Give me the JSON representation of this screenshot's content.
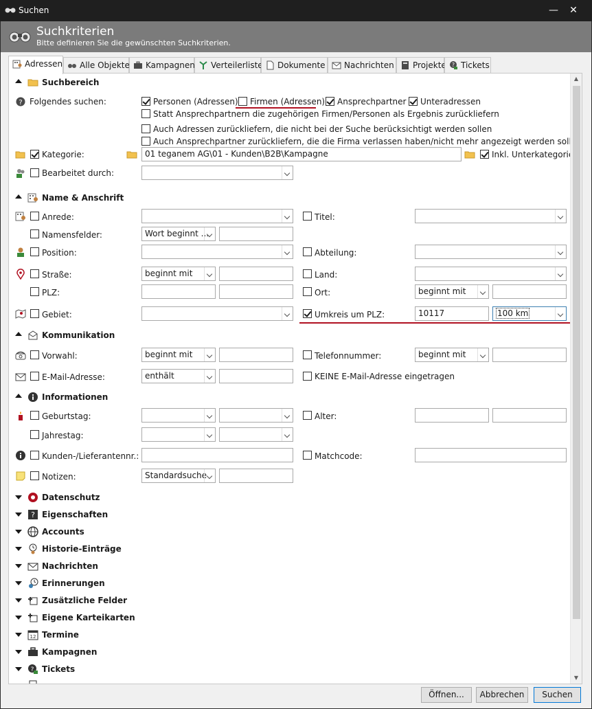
{
  "window": {
    "title": "Suchen",
    "minimize": "—",
    "close": "✕"
  },
  "header": {
    "title": "Suchkriterien",
    "subtitle": "Bitte definieren Sie die gewünschten Suchkriterien."
  },
  "tabs": [
    {
      "label": "Adressen",
      "icon": "address-book-icon",
      "active": true
    },
    {
      "label": "Alle Objekte",
      "icon": "binoculars-icon"
    },
    {
      "label": "Kampagnen",
      "icon": "briefcase-icon"
    },
    {
      "label": "Verteilerlisten",
      "icon": "distribution-icon"
    },
    {
      "label": "Dokumente",
      "icon": "document-icon"
    },
    {
      "label": "Nachrichten",
      "icon": "envelope-icon"
    },
    {
      "label": "Projekte",
      "icon": "book-icon"
    },
    {
      "label": "Tickets",
      "icon": "ticket-icon"
    }
  ],
  "suchbereich": {
    "title": "Suchbereich",
    "folgendes_label": "Folgendes suchen:",
    "personen": "Personen (Adressen)",
    "firmen": "Firmen (Adressen)",
    "ansprechpartner": "Ansprechpartner",
    "unteradressen": "Unteradressen",
    "statt": "Statt Ansprechpartnern die zugehörigen Firmen/Personen als Ergebnis zurückliefern",
    "auch_adressen": "Auch Adressen zurückliefern, die nicht bei der Suche berücksichtigt werden sollen",
    "auch_ansprech": "Auch Ansprechpartner zurückliefern, die die Firma verlassen haben/nicht mehr angezeigt werden sollen",
    "kategorie_label": "Kategorie:",
    "kategorie_value": "01 teganem AG\\01 - Kunden\\B2B\\Kampagne",
    "inkl_label": "Inkl. Unterkategorien",
    "bearbeitet_label": "Bearbeitet durch:"
  },
  "name": {
    "title": "Name & Anschrift",
    "anrede": "Anrede:",
    "titel": "Titel:",
    "namensfelder": "Namensfelder:",
    "namensfelder_mode": "Wort beginnt ...",
    "position": "Position:",
    "abteilung": "Abteilung:",
    "strasse": "Straße:",
    "strasse_mode": "beginnt mit",
    "land": "Land:",
    "plz": "PLZ:",
    "ort": "Ort:",
    "ort_mode": "beginnt mit",
    "gebiet": "Gebiet:",
    "umkreis": "Umkreis um PLZ:",
    "umkreis_plz": "10117",
    "umkreis_km": "100 km"
  },
  "kommunikation": {
    "title": "Kommunikation",
    "vorwahl": "Vorwahl:",
    "vorwahl_mode": "beginnt mit",
    "telefon": "Telefonnummer:",
    "telefon_mode": "beginnt mit",
    "email": "E-Mail-Adresse:",
    "email_mode": "enthält",
    "keine_email": "KEINE E-Mail-Adresse eingetragen"
  },
  "informationen": {
    "title": "Informationen",
    "geburtstag": "Geburtstag:",
    "alter": "Alter:",
    "jahrestag": "Jahrestag:",
    "kundennr": "Kunden-/Lieferantennr.:",
    "matchcode": "Matchcode:",
    "notizen": "Notizen:",
    "notizen_mode": "Standardsuche"
  },
  "collapsed_sections": [
    {
      "label": "Datenschutz",
      "icon": "privacy-icon"
    },
    {
      "label": "Eigenschaften",
      "icon": "question-icon"
    },
    {
      "label": "Accounts",
      "icon": "globe-icon"
    },
    {
      "label": "Historie-Einträge",
      "icon": "history-icon"
    },
    {
      "label": "Nachrichten",
      "icon": "envelope-icon"
    },
    {
      "label": "Erinnerungen",
      "icon": "reminder-icon"
    },
    {
      "label": "Zusätzliche Felder",
      "icon": "extra-fields-icon"
    },
    {
      "label": "Eigene Karteikarten",
      "icon": "custom-tabs-icon"
    },
    {
      "label": "Termine",
      "icon": "calendar-icon"
    },
    {
      "label": "Kampagnen",
      "icon": "briefcase-icon"
    },
    {
      "label": "Tickets",
      "icon": "ticket-icon"
    }
  ],
  "footer": {
    "open": "Öffnen...",
    "cancel": "Abbrechen",
    "search": "Suchen"
  },
  "colors": {
    "accent_red": "#b01020",
    "header_bg": "#7b7b7b",
    "titlebar_bg": "#1f1f1f"
  }
}
